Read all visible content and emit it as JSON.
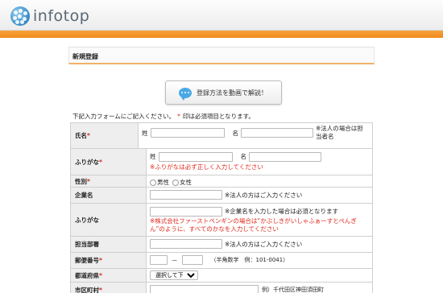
{
  "brand": {
    "name": "infotop"
  },
  "section_title": "新規登録",
  "video_button": {
    "label": "登録方法を動画で解説！"
  },
  "intro": {
    "text_before": "下記入力フォームにご記入ください。",
    "asterisk": "*",
    "text_after": "印は必須項目となります。"
  },
  "required_mark": "*",
  "rows": {
    "name": {
      "label": "氏名",
      "sei_label": "姓",
      "mei_label": "名",
      "note": "※法人の場合は担当者名"
    },
    "furigana": {
      "label": "ふりがな",
      "sei_label": "姓",
      "mei_label": "名",
      "warning": "※ふりがなは必ず正しく入力してください"
    },
    "gender": {
      "label": "性別",
      "male": "男性",
      "female": "女性"
    },
    "company": {
      "label": "企業名",
      "note": "※法人の方はご入力ください"
    },
    "company_furigana": {
      "label": "ふりがな",
      "note": "※企業名を入力した場合は必須となります",
      "warning": "※株式会社ファーストペンギンの場合は“かぶしきがいしゃふぁーすとぺんぎん”のように、すべてのかなを入力してください"
    },
    "department": {
      "label": "担当部署",
      "note": "※法人の方はご入力ください"
    },
    "postal": {
      "label": "郵便番号",
      "separator": "－",
      "hint": "（半角数字　例：101-0041）"
    },
    "prefecture": {
      "label": "都道府県",
      "selected": "選択して下さい"
    },
    "city": {
      "label": "市区町村",
      "hint": "例）千代田区神田須田町"
    }
  }
}
